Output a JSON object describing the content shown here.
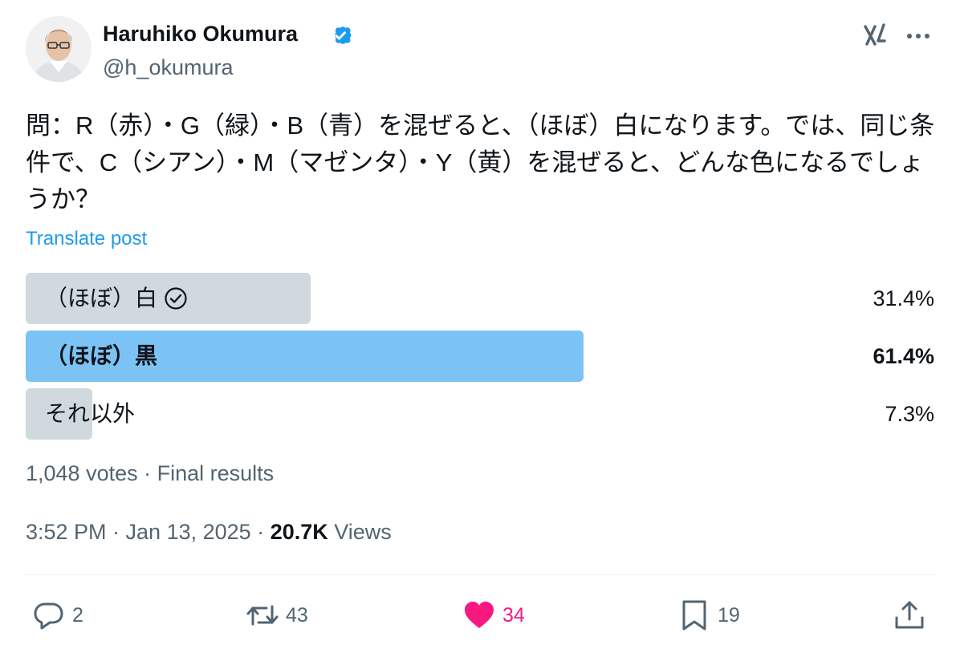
{
  "author": {
    "name": "Haruhiko Okumura",
    "handle": "@h_okumura"
  },
  "post": {
    "text": "問：R（赤）・G（緑）・B（青）を混ぜると、（ほぼ）白になります。では、同じ条件で、C（シアン）・M（マゼンタ）・Y（黄）を混ぜると、どんな色になるでしょうか？",
    "translate_label": "Translate post"
  },
  "poll": {
    "options": [
      {
        "label": "（ほぼ）白",
        "percent_label": "31.4%",
        "percent": 31.4,
        "checked": true,
        "winner": false
      },
      {
        "label": "（ほぼ）黒",
        "percent_label": "61.4%",
        "percent": 61.4,
        "checked": false,
        "winner": true
      },
      {
        "label": "それ以外",
        "percent_label": "7.3%",
        "percent": 7.3,
        "checked": false,
        "winner": false
      }
    ],
    "summary": "1,048 votes · Final results"
  },
  "meta": {
    "time_date": "3:52 PM · Jan 13, 2025 · ",
    "views_count": "20.7K",
    "views_label": "Views"
  },
  "actions": {
    "replies": "2",
    "reposts": "43",
    "likes": "34",
    "bookmarks": "19"
  },
  "colors": {
    "accent": "#1d9bf0",
    "winner_bar": "#7cc3f5",
    "bar": "#cfd9de",
    "like": "#f91880",
    "muted": "#536471"
  },
  "icons": {
    "verified": "verified-badge-icon",
    "grok": "grok-icon",
    "more": "more-icon",
    "check": "check-circle-icon",
    "reply": "reply-icon",
    "repost": "repost-icon",
    "like": "heart-icon",
    "bookmark": "bookmark-icon",
    "share": "share-icon"
  }
}
